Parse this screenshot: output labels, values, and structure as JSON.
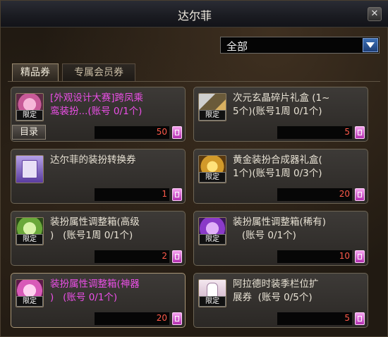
{
  "window": {
    "title": "达尔菲",
    "close_label": "✕"
  },
  "filter": {
    "selected": "全部"
  },
  "tabs": [
    {
      "label": "精品券"
    },
    {
      "label": "专属会员券"
    }
  ],
  "catalog_button": "目录",
  "limited_badge": "限定",
  "items": [
    {
      "name_line1": "[外观设计大赛]跨凤乘",
      "name_line2": "鸾装扮...(账号 0/1个)",
      "price": "50",
      "limited": true,
      "highlight": false,
      "icon": "pink-flower-box-icon"
    },
    {
      "name_line1": "次元玄晶碎片礼盒 (1~",
      "name_line2": "5个)(账号1周 0/1个)",
      "price": "5",
      "limited": true,
      "highlight": false,
      "icon": "crystal-box-icon"
    },
    {
      "name_line1": "达尔菲的装扮转换券",
      "name_line2": "",
      "price": "1",
      "limited": false,
      "highlight": false,
      "icon": "purple-ticket-icon"
    },
    {
      "name_line1": "黄金装扮合成器礼盒(",
      "name_line2": "1个)(账号1周 0/3个)",
      "price": "20",
      "limited": true,
      "highlight": false,
      "icon": "golden-box-icon"
    },
    {
      "name_line1": "装扮属性调整箱(高级",
      "name_line2": ")   (账号1周 0/1个)",
      "price": "2",
      "limited": true,
      "highlight": false,
      "icon": "green-box-icon"
    },
    {
      "name_line1": "装扮属性调整箱(稀有)",
      "name_line2": "   (账号 0/1个)",
      "price": "10",
      "limited": true,
      "highlight": false,
      "icon": "purple-box-icon"
    },
    {
      "name_line1": "装扮属性调整箱(神器",
      "name_line2": ")   (账号 0/1个)",
      "price": "20",
      "limited": true,
      "highlight": true,
      "icon": "pink-box-icon"
    },
    {
      "name_line1": "阿拉德时装季栏位扩",
      "name_line2": "展券  (账号 0/5个)",
      "price": "5",
      "limited": true,
      "highlight": false,
      "icon": "white-dress-icon"
    }
  ]
}
